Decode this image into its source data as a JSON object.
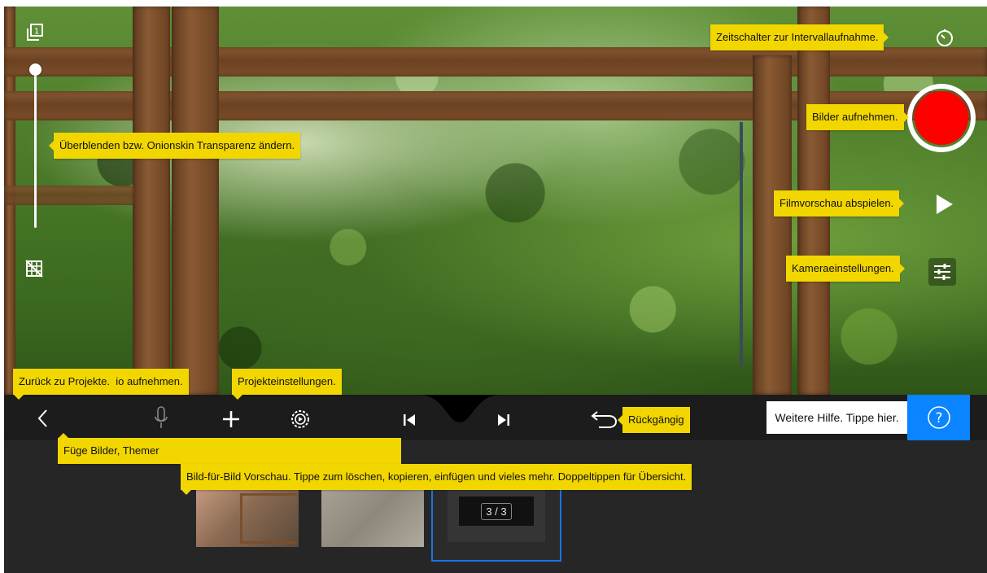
{
  "tooltips": {
    "interval": "Zeitschalter zur Intervallaufnahme.",
    "onion": "Überblenden bzw. Onionskin Transparenz ändern.",
    "capture": "Bilder aufnehmen.",
    "play": "Filmvorschau abspielen.",
    "camera_settings": "Kameraeinstellungen.",
    "back": "Zurück zu Projekte.",
    "audio": "io aufnehmen.",
    "project_settings": "Projekteinstellungen.",
    "add": "Füge Bilder, Themer",
    "undo": "Rückgängig",
    "filmstrip": "Bild-für-Bild Vorschau. Tippe zum löschen, kopieren, einfügen und vieles mehr. Doppeltippen für Übersicht."
  },
  "help": {
    "label": "Weitere Hilfe. Tippe hier.",
    "icon": "?"
  },
  "filmstrip": {
    "counter": "3 / 3"
  },
  "colors": {
    "tooltip": "#f2d600",
    "record": "#ff0000",
    "accent": "#0a84ff"
  }
}
